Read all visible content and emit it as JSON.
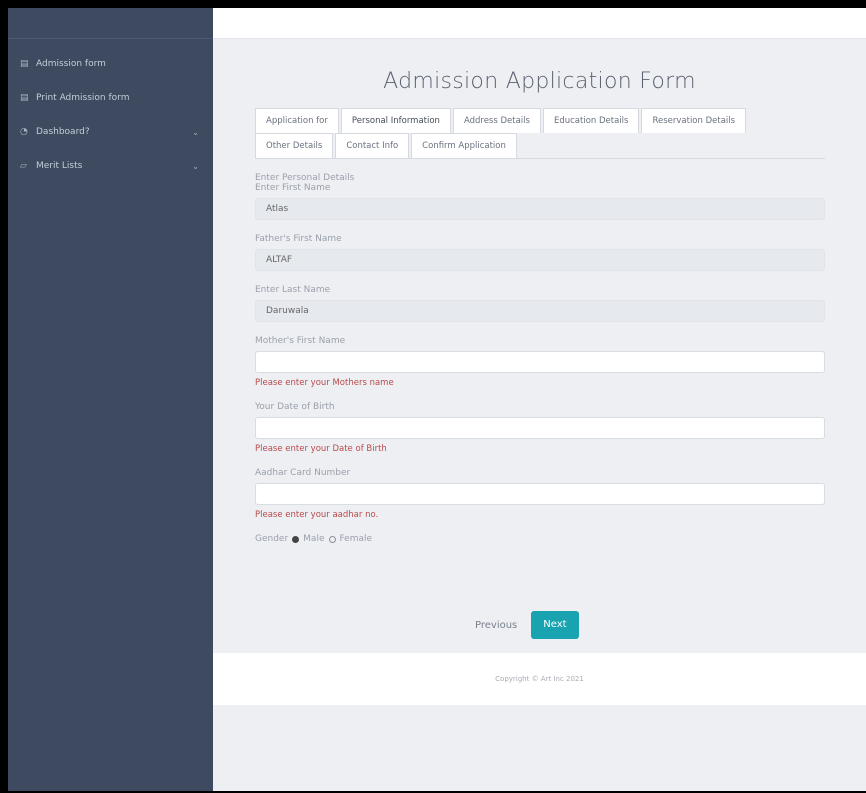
{
  "sidebar": {
    "items": [
      {
        "icon": "▤",
        "label": "Admission form",
        "chevron": ""
      },
      {
        "icon": "▤",
        "label": "Print Admission form",
        "chevron": ""
      },
      {
        "icon": "◔",
        "label": "Dashboard?",
        "chevron": "⌄"
      },
      {
        "icon": "▱",
        "label": "Merit Lists",
        "chevron": "⌄"
      }
    ]
  },
  "form": {
    "title": "Admission Application Form",
    "tabs_row1": [
      "Application for",
      "Personal Information",
      "Address Details",
      "Education Details"
    ],
    "tabs_row2": [
      "Reservation Details",
      "Other Details",
      "Contact Info",
      "Confirm Application"
    ],
    "section_heading": "Enter Personal Details",
    "first_name_label": "Enter First Name",
    "first_name_value": "Atlas",
    "father_label": "Father's First Name",
    "father_value": "ALTAF",
    "last_name_label": "Enter Last Name",
    "last_name_value": "Daruwala",
    "mother_label": "Mother's First Name",
    "mother_value": "",
    "mother_error": "Please enter your Mothers name",
    "dob_label": "Your Date of Birth",
    "dob_value": "",
    "dob_error": "Please enter your Date of Birth",
    "aadhar_label": "Aadhar Card Number",
    "aadhar_value": "",
    "aadhar_error": "Please enter your aadhar no.",
    "gender_label": "Gender",
    "gender_male": "Male",
    "gender_female": "Female",
    "gender_selected": "Male",
    "previous_label": "Previous",
    "next_label": "Next"
  },
  "footer": {
    "text": "Copyright © Art Inc 2021"
  },
  "colors": {
    "sidebar_bg": "#3d4a5f",
    "accent": "#19a2b0",
    "error": "#b84a4a"
  }
}
